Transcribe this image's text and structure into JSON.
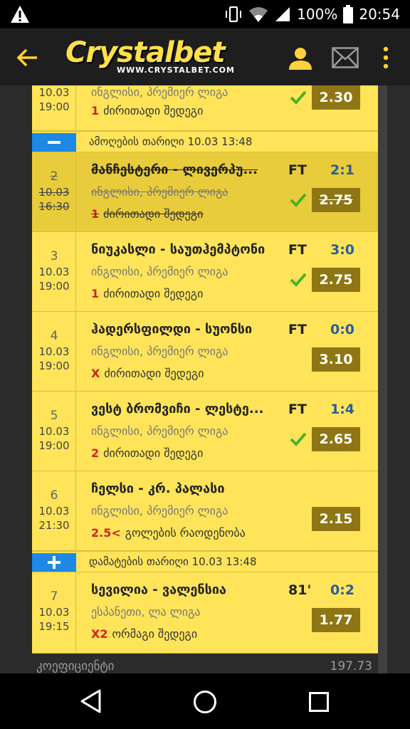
{
  "status_bar": {
    "battery": "100%",
    "time": "20:54",
    "icons": [
      "warning-icon",
      "vibrate-icon",
      "wifi-icon",
      "signal-icon",
      "battery-icon"
    ]
  },
  "app_bar": {
    "brand": "Crystalbet",
    "url": "WWW.CRYSTALBET.COM",
    "icons": [
      "back-arrow-icon",
      "user-icon",
      "mail-icon",
      "more-vert-icon"
    ]
  },
  "rows_top": [
    {
      "idx": "",
      "date": "10.03",
      "time": "19:00",
      "title": "",
      "status": "",
      "score": "",
      "league": "ინგლისი, პრემიერ ლიგა",
      "selection": "1",
      "pick": "ძირითადი შედეგი",
      "odds": "2.30",
      "won": true
    }
  ],
  "separator_removed": "ამოღების თარიღი 10.03 13:48",
  "rows": [
    {
      "idx": "2",
      "date": "10.03",
      "time": "16:30",
      "title": "მანჩესტერი - ლივერპუ...",
      "status": "FT",
      "score": "2:1",
      "league": "ინგლისი, პრემიერ ლიგა",
      "selection": "1",
      "pick": "ძირითადი შედეგი",
      "odds": "2.75",
      "won": true
    },
    {
      "idx": "3",
      "date": "10.03",
      "time": "19:00",
      "title": "ნიუკასლი - საუთჰემპტონი",
      "status": "FT",
      "score": "3:0",
      "league": "ინგლისი, პრემიერ ლიგა",
      "selection": "1",
      "pick": "ძირითადი შედეგი",
      "odds": "2.75",
      "won": true
    },
    {
      "idx": "4",
      "date": "10.03",
      "time": "19:00",
      "title": "ჰადერსფილდი - სუონსი",
      "status": "FT",
      "score": "0:0",
      "league": "ინგლისი, პრემიერ ლიგა",
      "selection": "X",
      "pick": "ძირითადი შედეგი",
      "odds": "3.10",
      "won": false
    },
    {
      "idx": "5",
      "date": "10.03",
      "time": "19:00",
      "title": "ვესტ ბრომვიჩი - ლესტე...",
      "status": "FT",
      "score": "1:4",
      "league": "ინგლისი, პრემიერ ლიგა",
      "selection": "2",
      "pick": "ძირითადი შედეგი",
      "odds": "2.65",
      "won": true
    },
    {
      "idx": "6",
      "date": "10.03",
      "time": "21:30",
      "title": "ჩელსი - კრ. პალასი",
      "status": "",
      "score": "",
      "league": "ინგლისი, პრემიერ ლიგა",
      "selection": "2.5<",
      "pick": "გოლების რაოდენობა",
      "odds": "2.15",
      "won": false
    }
  ],
  "separator_added": "დამატების თარიღი 10.03 13:48",
  "rows_added": [
    {
      "idx": "7",
      "date": "10.03",
      "time": "19:15",
      "title": "სევილია - ვალენსია",
      "status": "81'",
      "score": "0:2",
      "league": "ესპანეთი, ლა ლიგა",
      "selection": "X2",
      "pick": "ორმაგი შედეგი",
      "odds": "1.77",
      "won": false
    }
  ],
  "footer": {
    "label": "კოეფიციენტი",
    "value": "197.73"
  },
  "nav_bar": {
    "icons": [
      "nav-back-icon",
      "nav-home-icon",
      "nav-recents-icon"
    ]
  }
}
